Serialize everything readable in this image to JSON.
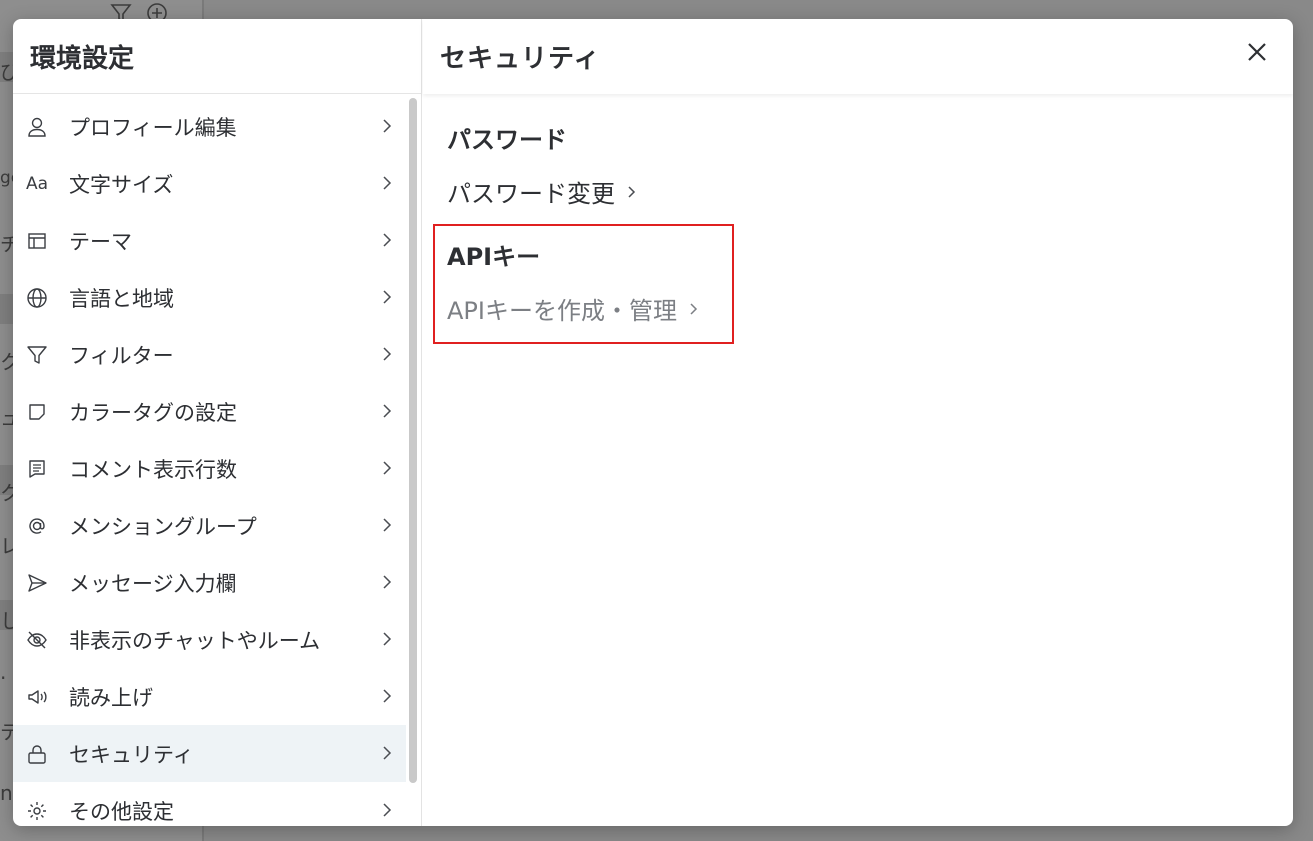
{
  "background": {
    "fragments": [
      "び",
      "ge",
      "チ",
      "ク",
      "ュ",
      "ク",
      "レ",
      "し",
      ".",
      "テ",
      "nF"
    ]
  },
  "left_pane": {
    "title": "環境設定",
    "items": [
      {
        "label": "プロフィール編集",
        "icon": "user-icon"
      },
      {
        "label": "文字サイズ",
        "icon": "font-size-icon",
        "icon_text": "Aa"
      },
      {
        "label": "テーマ",
        "icon": "theme-layout-icon"
      },
      {
        "label": "言語と地域",
        "icon": "globe-icon"
      },
      {
        "label": "フィルター",
        "icon": "filter-icon"
      },
      {
        "label": "カラータグの設定",
        "icon": "tag-icon"
      },
      {
        "label": "コメント表示行数",
        "icon": "comment-icon"
      },
      {
        "label": "メンショングループ",
        "icon": "at-sign-icon"
      },
      {
        "label": "メッセージ入力欄",
        "icon": "send-icon"
      },
      {
        "label": "非表示のチャットやルーム",
        "icon": "eye-off-icon"
      },
      {
        "label": "読み上げ",
        "icon": "megaphone-icon"
      },
      {
        "label": "セキュリティ",
        "icon": "lock-icon",
        "active": true
      },
      {
        "label": "その他設定",
        "icon": "gear-icon"
      }
    ]
  },
  "right_pane": {
    "title": "セキュリティ",
    "password": {
      "heading": "パスワード",
      "link": "パスワード変更"
    },
    "api_key": {
      "heading": "APIキー",
      "link": "APIキーを作成・管理"
    }
  },
  "colors": {
    "text_primary": "#2d2f33",
    "text_muted": "#7c7f84",
    "active_item_bg": "#eef3f6",
    "highlight_border": "#e02020",
    "overlay": "#898989"
  }
}
